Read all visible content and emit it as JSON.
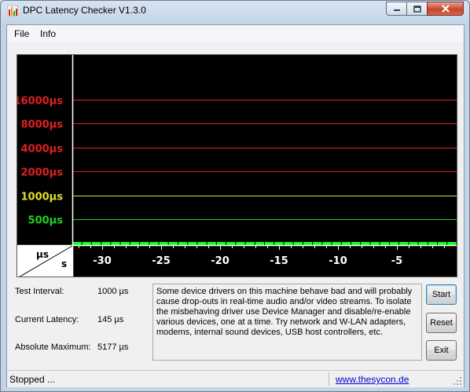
{
  "window": {
    "title": "DPC Latency Checker V1.3.0",
    "icon": "bar-chart-app-icon",
    "caption_buttons": [
      "minimize-icon",
      "maximize-icon",
      "close-icon"
    ]
  },
  "menu": [
    "File",
    "Info"
  ],
  "graph": {
    "y_axis_unit": "µs",
    "x_axis_unit": "s",
    "levels": [
      {
        "label": "16000µs",
        "value": 16000,
        "color": "#e02020"
      },
      {
        "label": "8000µs",
        "value": 8000,
        "color": "#e02020"
      },
      {
        "label": "4000µs",
        "value": 4000,
        "color": "#e02020"
      },
      {
        "label": "2000µs",
        "value": 2000,
        "color": "#e02020"
      },
      {
        "label": "1000µs",
        "value": 1000,
        "color": "#e0e020"
      },
      {
        "label": "500µs",
        "value": 500,
        "color": "#20d020"
      }
    ],
    "x_ticks": [
      "-30",
      "-25",
      "-20",
      "-15",
      "-10",
      "-5"
    ],
    "bar_color": "#1aff1a",
    "bar_values_us": [
      140,
      140,
      175,
      120,
      110,
      110,
      120,
      110,
      140,
      110,
      180,
      120,
      120,
      125,
      135,
      125,
      125,
      125,
      110,
      110,
      125,
      135,
      135,
      140,
      125,
      125,
      135,
      125,
      125,
      120,
      200,
      120,
      110,
      130,
      150,
      125,
      120,
      125,
      125,
      150
    ]
  },
  "stats": {
    "test_interval_label": "Test Interval:",
    "test_interval_value": "1000 µs",
    "current_latency_label": "Current Latency:",
    "current_latency_value": "145 µs",
    "absolute_maximum_label": "Absolute Maximum:",
    "absolute_maximum_value": "5177 µs"
  },
  "info_text": "Some device drivers on this machine behave bad and will probably\ncause drop-outs in real-time audio and/or video streams. To isolate\nthe misbehaving driver use Device Manager and disable/re-enable\nvarious devices, one at a time. Try network and W-LAN adapters,\nmodems, internal sound devices, USB host controllers, etc.",
  "buttons": {
    "start": "Start",
    "reset": "Reset",
    "exit": "Exit"
  },
  "status": {
    "text": "Stopped ...",
    "link": "www.thesycon.de"
  }
}
